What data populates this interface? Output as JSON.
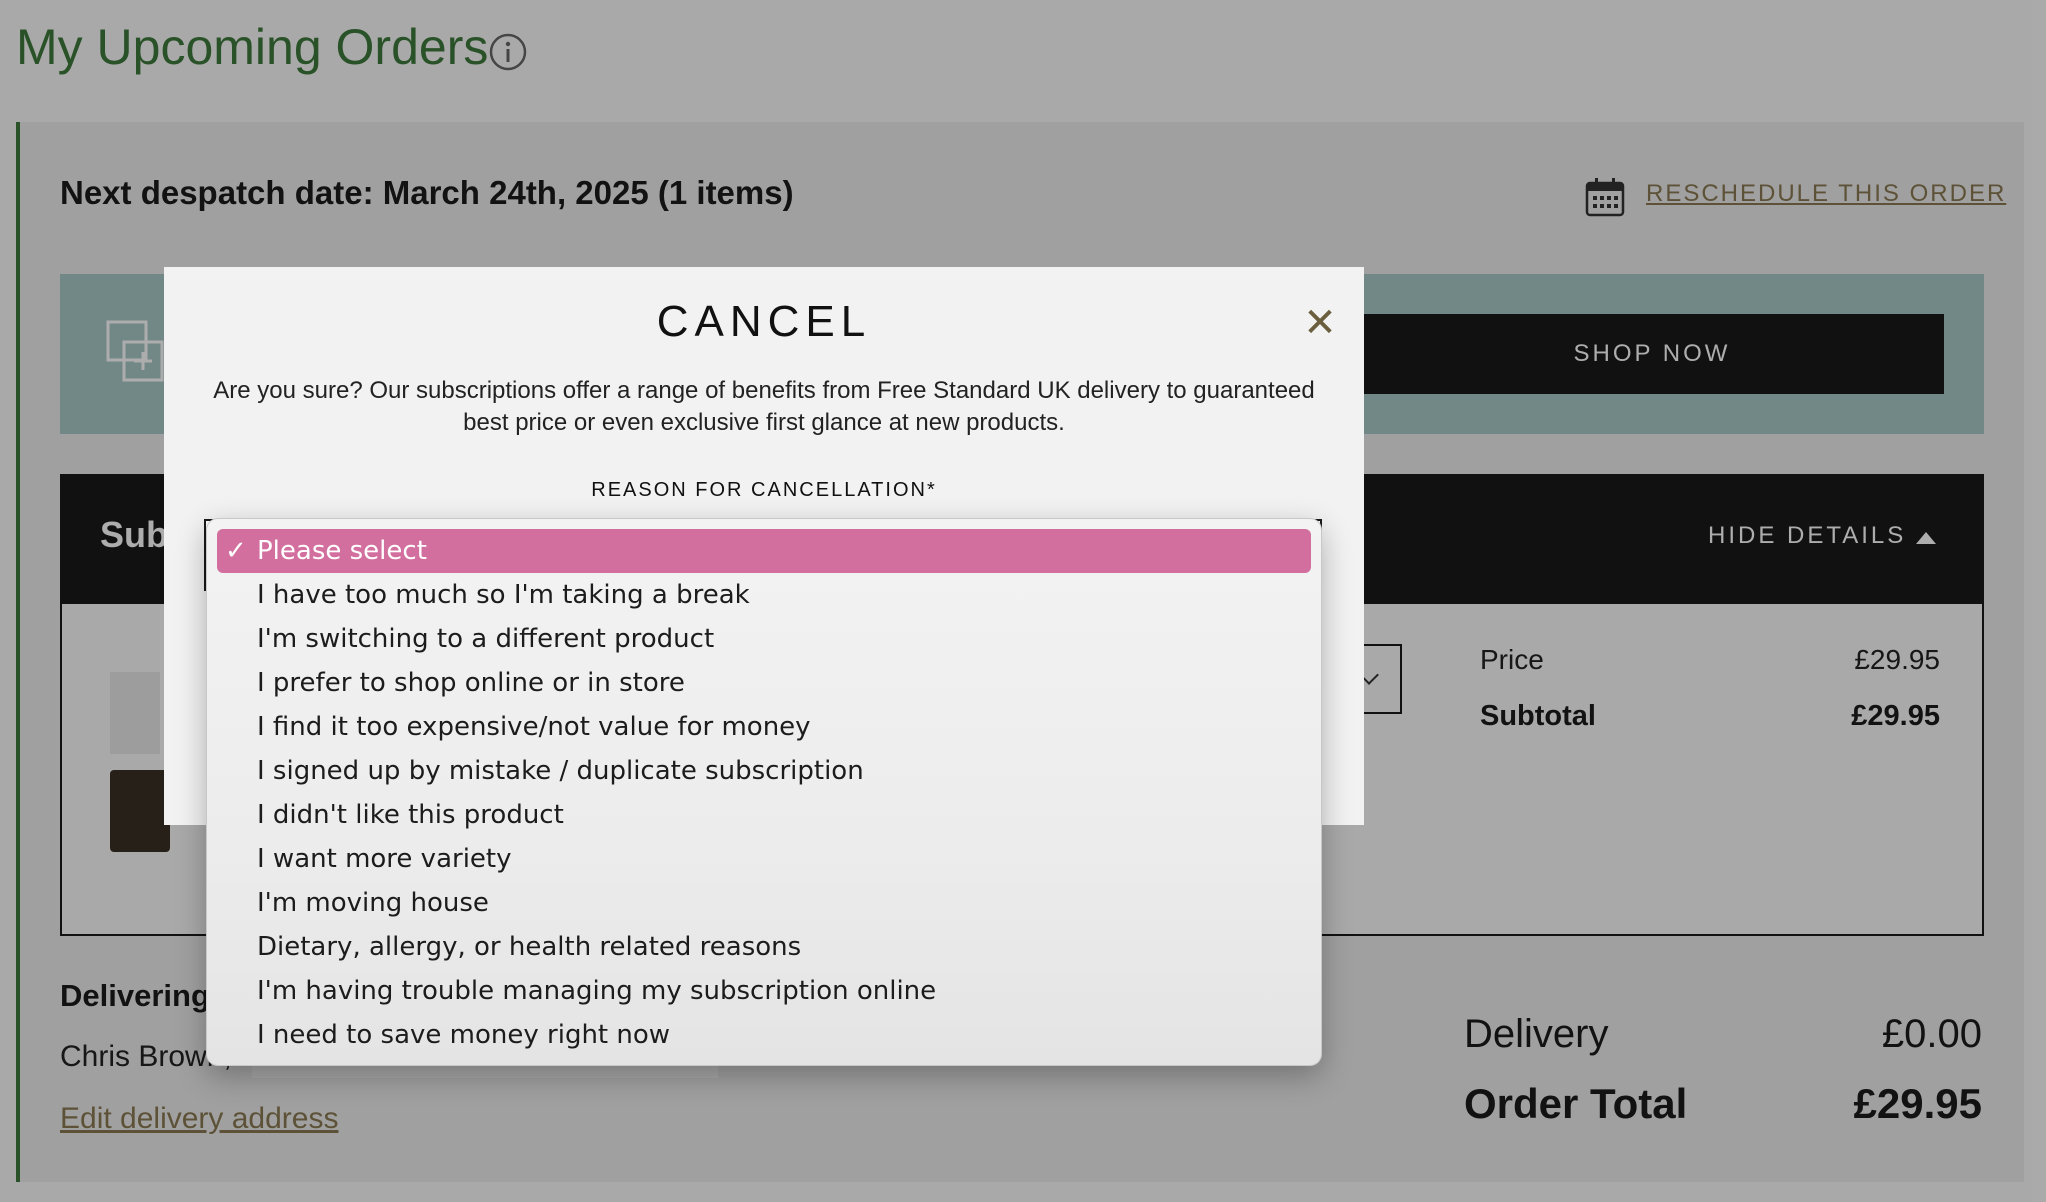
{
  "page": {
    "title": "My Upcoming Orders",
    "despatch": "Next despatch date: March 24th, 2025 (1 items)",
    "reschedule_label": "RESCHEDULE THIS ORDER",
    "shop_now_label": "SHOP NOW",
    "subscription_title": "Sub",
    "hide_details_label": "HIDE DETAILS",
    "price_label": "Price",
    "price_value": "£29.95",
    "subtotal_label": "Subtotal",
    "subtotal_value": "£29.95",
    "delivering_label": "Delivering",
    "delivering_name": "Chris Brown,",
    "edit_address_label": "Edit delivery address",
    "delivery_label": "Delivery",
    "delivery_value": "£0.00",
    "order_total_label": "Order Total",
    "order_total_value": "£29.95"
  },
  "modal": {
    "title": "CANCEL",
    "close_glyph": "✕",
    "description": "Are you sure? Our subscriptions offer a range of benefits from Free Standard UK delivery to guaranteed best price or even exclusive first glance at new products.",
    "reason_label": "REASON FOR CANCELLATION*"
  },
  "dropdown": {
    "check_glyph": "✓",
    "options": [
      "Please select",
      "I have too much so I'm taking a break",
      "I'm switching to a different product",
      "I prefer to shop online or in store",
      "I find it too expensive/not value for money",
      "I signed up by mistake / duplicate subscription",
      "I didn't like this product",
      "I want more variety",
      "I'm moving house",
      "Dietary, allergy, or health related reasons",
      "I'm having trouble managing my subscription online",
      "I need to save money right now"
    ],
    "selected_option": "Please select"
  },
  "colors": {
    "brand_green": "#3f7a3c",
    "accent_gold": "#8a7a52",
    "selected_pink": "#d36f9e"
  }
}
